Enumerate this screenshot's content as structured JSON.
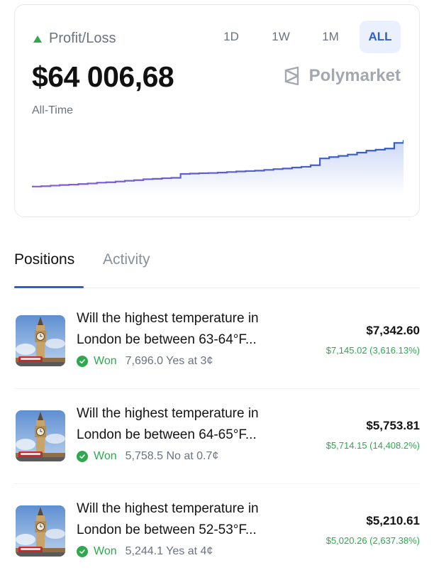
{
  "profit_loss": {
    "title": "Profit/Loss",
    "amount": "$64 006,68",
    "period_label": "All-Time",
    "trend": "up",
    "brand": "Polymarket",
    "ranges": [
      "1D",
      "1W",
      "1M",
      "ALL"
    ],
    "selected_range": "ALL",
    "colors": {
      "up": "#2fa84f",
      "accent": "#2f5ec4",
      "line_start": "#8a5cd8",
      "line_end": "#2f5ec4"
    },
    "chart_data": {
      "type": "area",
      "x": [
        0,
        1,
        2,
        3,
        4,
        5,
        6,
        7,
        8,
        9,
        10,
        11,
        12,
        13,
        14,
        15,
        16,
        17,
        18,
        19,
        20,
        21,
        22,
        23,
        24,
        25,
        26,
        27,
        28,
        29,
        30,
        31,
        32,
        33,
        34,
        35,
        36,
        37,
        38,
        39,
        40
      ],
      "values": [
        3,
        3.2,
        3.5,
        3.8,
        4,
        4.3,
        4.6,
        5,
        5.2,
        5.6,
        6,
        6.3,
        6.8,
        7,
        7.3,
        7.5,
        9.5,
        9.7,
        9.9,
        10,
        10.2,
        10.5,
        10.8,
        11,
        11.2,
        11.6,
        12,
        12.3,
        12.8,
        13.2,
        14,
        17.5,
        18.2,
        18.8,
        19.5,
        20.5,
        21.5,
        22,
        22.6,
        25.5,
        27
      ],
      "ylim": [
        0,
        30
      ],
      "grid": false
    }
  },
  "tabs": {
    "positions": "Positions",
    "activity": "Activity",
    "active": "positions"
  },
  "positions": [
    {
      "question_line1": "Will the highest temperature in",
      "question_line2": "London be between 63-64°F...",
      "status": "Won",
      "shares": "7,696.0 Yes at 3¢",
      "value": "$7,342.60",
      "pnl": "$7,145.02 (3,616.13%)",
      "thumb_icon": "big-ben-photo"
    },
    {
      "question_line1": "Will the highest temperature in",
      "question_line2": "London be between 64-65°F...",
      "status": "Won",
      "shares": "5,758.5 No at 0.7¢",
      "value": "$5,753.81",
      "pnl": "$5,714.15 (14,408.2%)",
      "thumb_icon": "big-ben-photo"
    },
    {
      "question_line1": "Will the highest temperature in",
      "question_line2": "London be between 52-53°F...",
      "status": "Won",
      "shares": "5,244.1 Yes at 4¢",
      "value": "$5,210.61",
      "pnl": "$5,020.26 (2,637.38%)",
      "thumb_icon": "big-ben-photo"
    }
  ]
}
